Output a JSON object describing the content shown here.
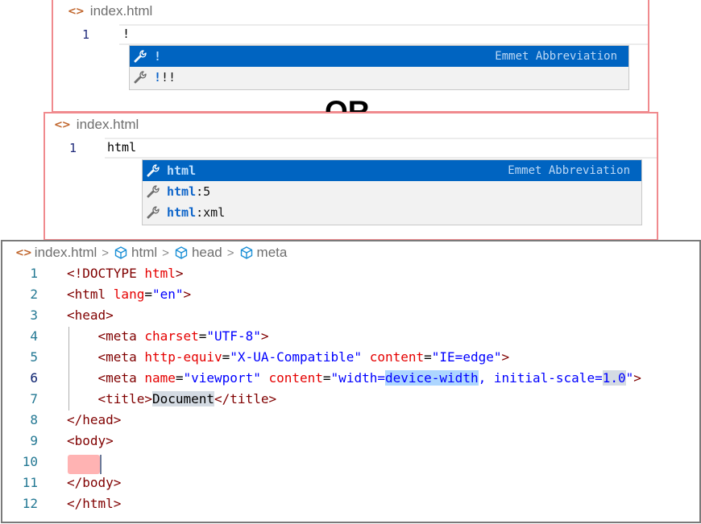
{
  "panel_a": {
    "tab_title": "index.html",
    "line_number": "1",
    "typed_text": "!",
    "suggestions": [
      {
        "prefix": "!",
        "suffix": "",
        "detail": "Emmet Abbreviation",
        "selected": true
      },
      {
        "prefix": "!",
        "suffix": "!!",
        "detail": "",
        "selected": false
      }
    ]
  },
  "separator": {
    "label": "OR"
  },
  "panel_b": {
    "tab_title": "index.html",
    "line_number": "1",
    "typed_text": "html",
    "suggestions": [
      {
        "prefix": "html",
        "suffix": "",
        "detail": "Emmet Abbreviation",
        "selected": true
      },
      {
        "prefix": "html",
        "suffix": ":5",
        "detail": "",
        "selected": false
      },
      {
        "prefix": "html",
        "suffix": ":xml",
        "detail": "",
        "selected": false
      }
    ]
  },
  "panel_c": {
    "breadcrumb": [
      {
        "label": "index.html",
        "icon": "code-file-icon"
      },
      {
        "label": "html",
        "icon": "cube-icon"
      },
      {
        "label": "head",
        "icon": "cube-icon"
      },
      {
        "label": "meta",
        "icon": "cube-icon"
      }
    ],
    "breadcrumb_separator": ">",
    "active_line": "6",
    "lines": [
      {
        "n": "1",
        "tokens": [
          [
            "tg",
            "<!DOCTYPE "
          ],
          [
            "at",
            "html"
          ],
          [
            "tg",
            ">"
          ]
        ]
      },
      {
        "n": "2",
        "tokens": [
          [
            "tg",
            "<html "
          ],
          [
            "at",
            "lang"
          ],
          [
            "tx",
            "="
          ],
          [
            "vl",
            "\"en\""
          ],
          [
            "tg",
            ">"
          ]
        ]
      },
      {
        "n": "3",
        "tokens": [
          [
            "tg",
            "<head>"
          ]
        ]
      },
      {
        "n": "4",
        "tokens": [
          [
            "tx",
            "    "
          ],
          [
            "tg",
            "<meta "
          ],
          [
            "at",
            "charset"
          ],
          [
            "tx",
            "="
          ],
          [
            "vl",
            "\"UTF-8\""
          ],
          [
            "tg",
            ">"
          ]
        ]
      },
      {
        "n": "5",
        "tokens": [
          [
            "tx",
            "    "
          ],
          [
            "tg",
            "<meta "
          ],
          [
            "at",
            "http-equiv"
          ],
          [
            "tx",
            "="
          ],
          [
            "vl",
            "\"X-UA-Compatible\""
          ],
          [
            "tx",
            " "
          ],
          [
            "at",
            "content"
          ],
          [
            "tx",
            "="
          ],
          [
            "vl",
            "\"IE=edge\""
          ],
          [
            "tg",
            ">"
          ]
        ]
      },
      {
        "n": "6",
        "tokens": [
          [
            "tx",
            "    "
          ],
          [
            "tg",
            "<meta "
          ],
          [
            "at",
            "name"
          ],
          [
            "tx",
            "="
          ],
          [
            "vl",
            "\"viewport\""
          ],
          [
            "tx",
            " "
          ],
          [
            "at",
            "content"
          ],
          [
            "tx",
            "="
          ],
          [
            "vl",
            "\"width="
          ],
          [
            "vl sel1",
            "device-width"
          ],
          [
            "vl",
            ", initial-scale="
          ],
          [
            "vl sel2",
            "1.0"
          ],
          [
            "vl",
            "\""
          ],
          [
            "tg",
            ">"
          ]
        ]
      },
      {
        "n": "7",
        "tokens": [
          [
            "tx",
            "    "
          ],
          [
            "tg",
            "<title>"
          ],
          [
            "tx sel2",
            "Document"
          ],
          [
            "tg",
            "</title>"
          ]
        ]
      },
      {
        "n": "8",
        "tokens": [
          [
            "tg",
            "</head>"
          ]
        ]
      },
      {
        "n": "9",
        "tokens": [
          [
            "tg",
            "<body>"
          ]
        ]
      },
      {
        "n": "10",
        "tokens": []
      },
      {
        "n": "11",
        "tokens": [
          [
            "tg",
            "</body>"
          ]
        ]
      },
      {
        "n": "12",
        "tokens": [
          [
            "tg",
            "</html>"
          ]
        ]
      }
    ]
  }
}
